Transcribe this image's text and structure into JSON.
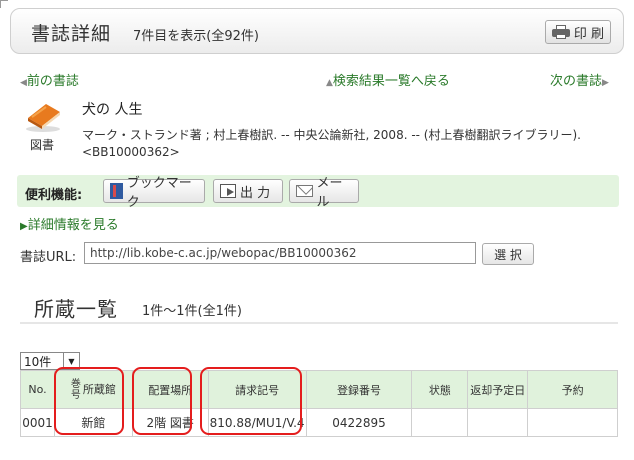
{
  "header": {
    "title": "書誌詳細",
    "count": "7件目を表示(全92件)",
    "print_label": "印 刷"
  },
  "nav": {
    "prev": "前の書誌",
    "list": "検索結果一覧へ戻る",
    "next": "次の書誌"
  },
  "record": {
    "icon_label": "図書",
    "title": "犬の 人生",
    "info": "マーク・ストランド著 ; 村上春樹訳. -- 中央公論新社, 2008. -- (村上春樹翻訳ライブラリー).",
    "id": "<BB10000362>"
  },
  "tools": {
    "label": "便利機能:",
    "bookmark": "ブックマーク",
    "output": "出 力",
    "mail": "メール"
  },
  "detail_link": "詳細情報を見る",
  "url": {
    "label": "書誌URL:",
    "value": "http://lib.kobe-c.ac.jp/webopac/BB10000362",
    "select": "選 択"
  },
  "holdings": {
    "title": "所蔵一覧",
    "count": "1件～1件(全1件)",
    "per_page": "10件",
    "columns": {
      "no": "No.",
      "vol": "巻号",
      "library": "所蔵館",
      "location": "配置場所",
      "callno": "請求記号",
      "regno": "登録番号",
      "status": "状態",
      "due": "返却予定日",
      "reserve": "予約"
    },
    "rows": [
      {
        "no": "0001",
        "vol": "",
        "library": "新館",
        "location": "2階 図書",
        "callno": "810.88/MU1/V.4",
        "regno": "0422895",
        "status": "",
        "due": "",
        "reserve": ""
      }
    ]
  },
  "colors": {
    "accent_green": "#2a7a2a",
    "bar_green": "#e3f4df",
    "highlight_red": "#e41d1d"
  }
}
